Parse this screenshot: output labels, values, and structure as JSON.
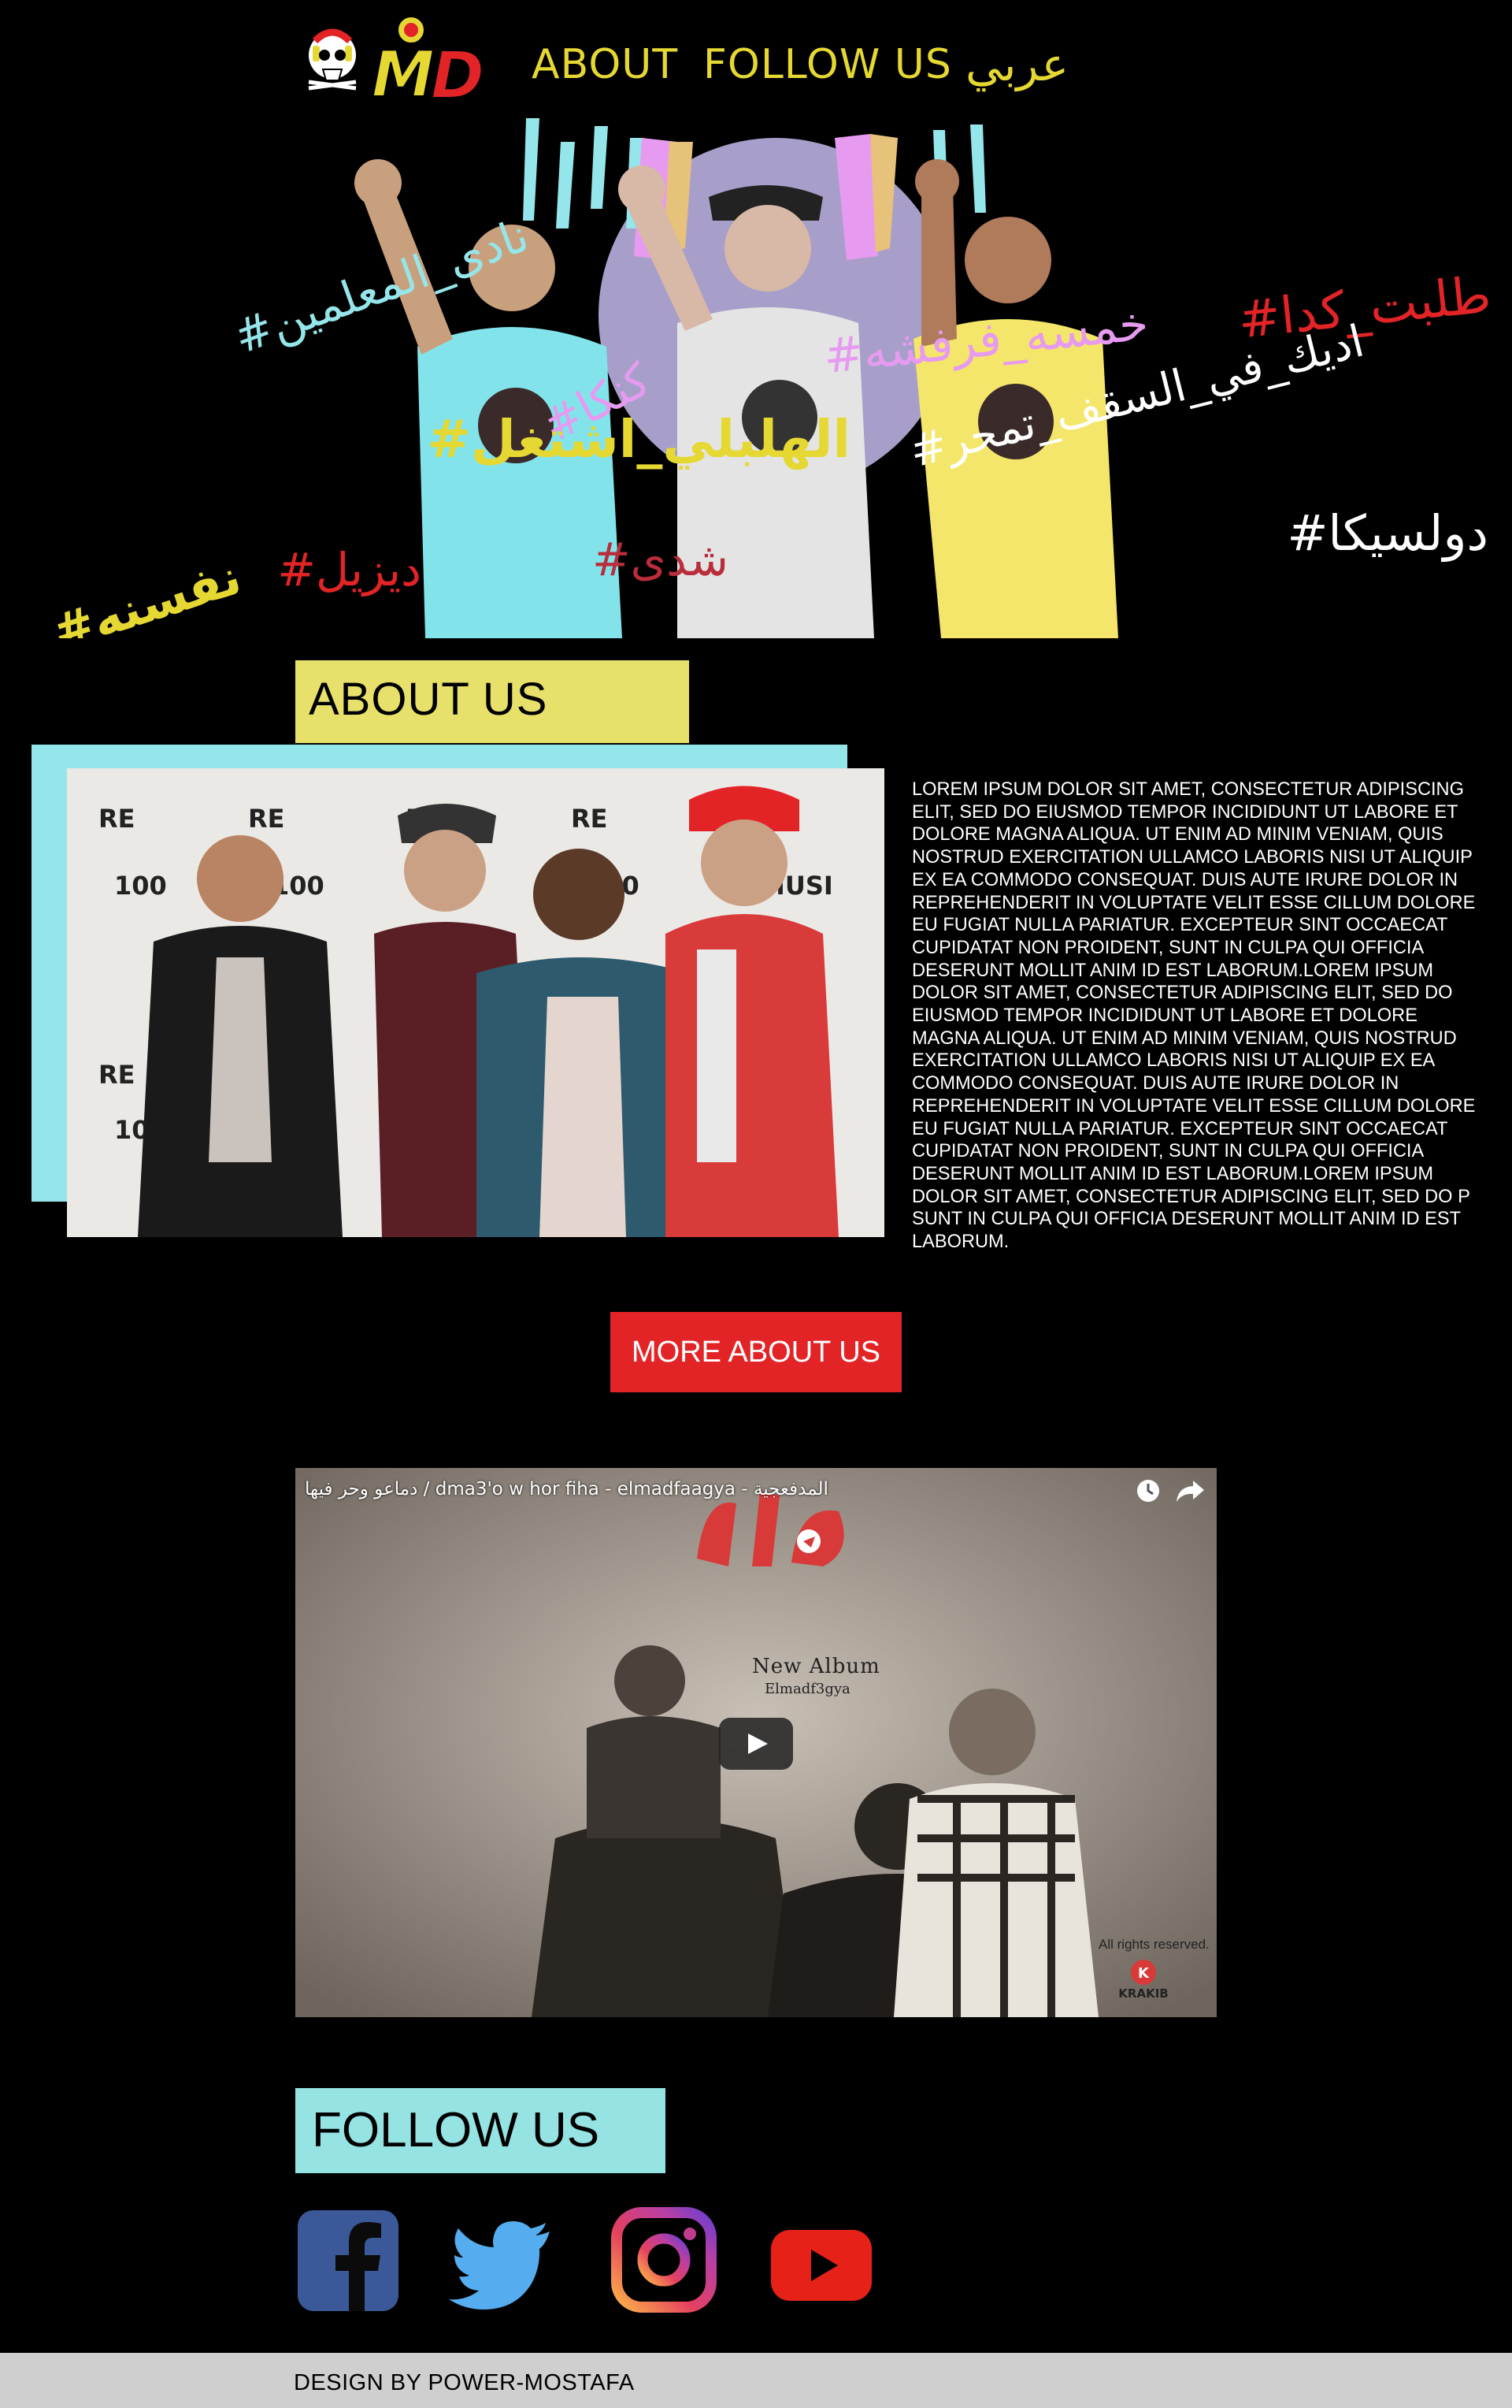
{
  "nav": {
    "about": "ABOUT",
    "follow": "FOLLOW US",
    "arabic": "عربي"
  },
  "logo": {
    "text": "MD"
  },
  "hero": {
    "hashtags": [
      {
        "text": "#طلبت_كدا",
        "color": "#e32427"
      },
      {
        "text": "#اديك_في_السقف_تمحر",
        "color": "#ffffff"
      },
      {
        "text": "#خمسه_فرفشه",
        "color": "#e79bf0"
      },
      {
        "text": "#كنكا",
        "color": "#e79bf0"
      },
      {
        "text": "#نادى_المعلمين",
        "color": "#95e6ea"
      },
      {
        "text": "#الهلبلي_اشتغل",
        "color": "#e6d832"
      },
      {
        "text": "#نفسنه",
        "color": "#e6d832"
      },
      {
        "text": "#ديزيل",
        "color": "#e32427"
      },
      {
        "text": "#شدى",
        "color": "#b92d3c"
      },
      {
        "text": "#دولسيكا",
        "color": "#ffffff"
      }
    ]
  },
  "about": {
    "title": "ABOUT US",
    "body": "Lorem ipsum dolor sit amet, consectetur adipiscing elit, sed do eiusmod tempor incididunt ut labore et dolore magna aliqua. Ut enim ad minim veniam, quis nostrud exercitation ullamco laboris nisi ut aliquip ex ea commodo consequat. Duis aute irure dolor in reprehenderit in voluptate velit esse cillum dolore eu fugiat nulla pariatur. Excepteur sint occaecat cupidatat non proident, sunt in culpa qui officia deserunt mollit anim id est laborum.Lorem ipsum dolor sit amet, consectetur adipiscing elit, sed do eiusmod tempor incididunt ut labore et dolore magna aliqua. Ut enim ad minim veniam, quis nostrud exercitation ullamco laboris nisi ut aliquip ex ea commodo consequat. Duis aute irure dolor in reprehenderit in voluptate velit esse cillum dolore eu fugiat nulla pariatur. Excepteur sint occaecat cupidatat non proident, sunt in culpa qui officia deserunt mollit anim id est laborum.Lorem ipsum dolor sit amet, consectetur adipiscing elit, sed do p sunt in culpa qui officia deserunt mollit anim id est laborum.",
    "button": "MORE ABOUT US",
    "accent_cyan": "#95e6ea",
    "accent_yellow": "#e7e06b",
    "accent_red": "#e32427"
  },
  "video": {
    "title": "دماعو وحر فيها / dma3'o w hor fiha - elmadfaagya - المدفعجية",
    "album_label": "New Album",
    "album_artist": "Elmadf3gya",
    "rights": "All rights reserved.",
    "label_logo": "KRAKIB"
  },
  "follow": {
    "title": "FOLLOW US",
    "icons": [
      "facebook-icon",
      "twitter-icon",
      "instagram-icon",
      "youtube-icon"
    ]
  },
  "footer": {
    "text": "DESIGN BY POWER-MOSTAFA"
  }
}
